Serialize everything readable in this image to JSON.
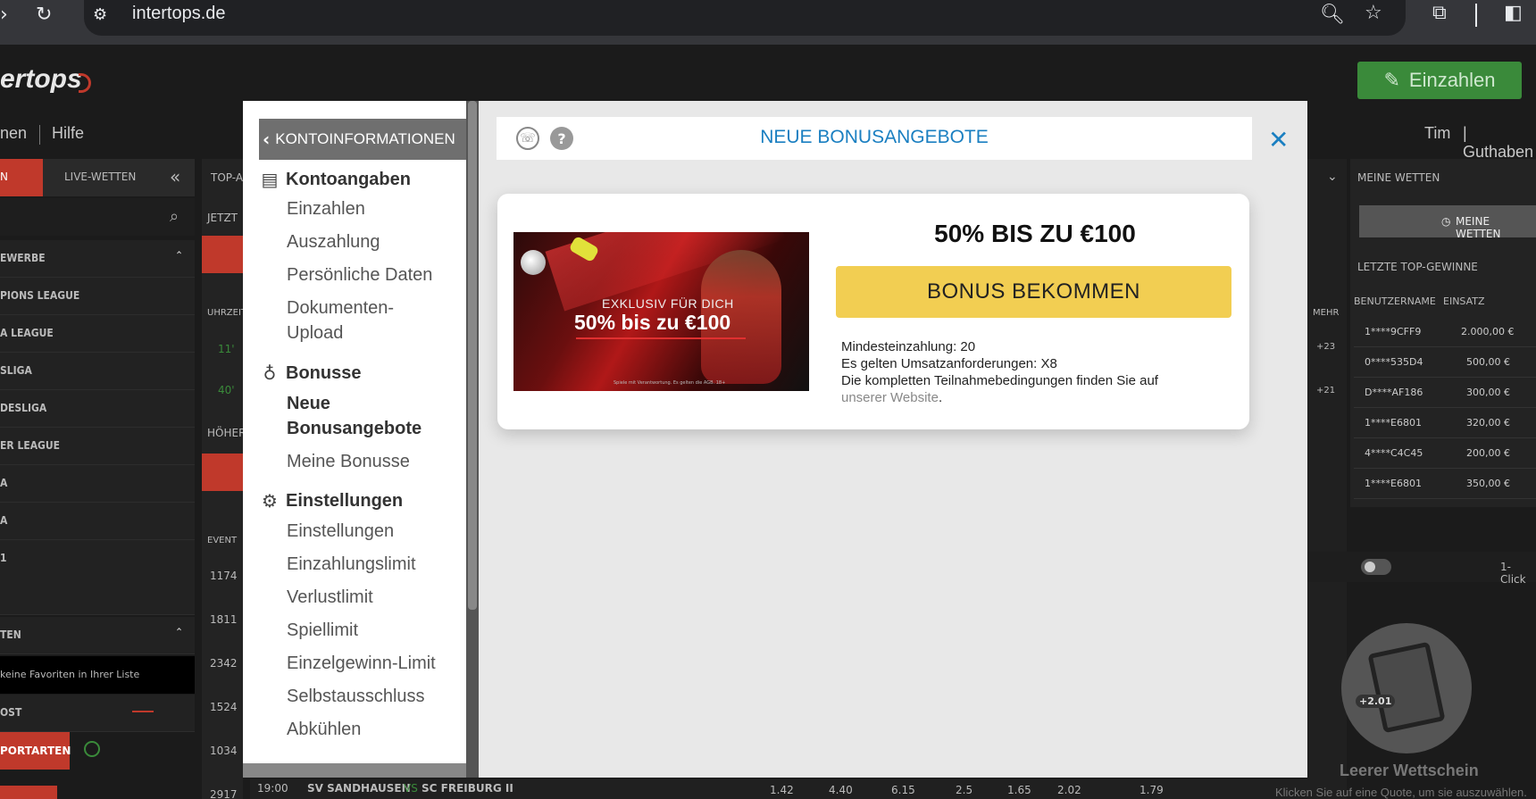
{
  "browser": {
    "url": "intertops.de"
  },
  "site": {
    "logo_text": "ertops",
    "deposit_label": "Einzahlen",
    "nav_left": [
      "nen",
      "Hilfe"
    ],
    "nav_right": [
      "Tim",
      "| Guthaben"
    ],
    "left_tabs": [
      "N",
      "LIVE-WETTEN"
    ],
    "left_sections": [
      "EWERBE",
      "PIONS LEAGUE",
      "A LEAGUE",
      "SLIGA",
      "DESLIGA",
      "ER LEAGUE",
      "A",
      "A",
      "1"
    ],
    "favorites_head": "TEN",
    "favorites_empty": "keine Favoriten in Ihrer Liste",
    "ost_label": "OST",
    "sportarten_label": "PORTARTEN",
    "center_labels": {
      "top": "TOP-A",
      "jetzt": "JETZT",
      "uhrzeit": "UHRZEIT",
      "hoher": "HÖHER",
      "event": "EVENT",
      "mehr": "MEHR",
      "time_11": "11'",
      "time_40": "40'",
      "plus_23": "+23",
      "plus_21": "+21"
    },
    "events": [
      "1174",
      "1811",
      "2342",
      "1524",
      "1034",
      "2917"
    ],
    "bottom_match": {
      "time": "19:00",
      "home": "SV SANDHAUSEN",
      "vs": "VS",
      "away": "SC FREIBURG II",
      "odds": [
        "1.42",
        "4.40",
        "6.15",
        "2.5",
        "1.65",
        "2.02",
        "1.79"
      ]
    },
    "right": {
      "my_bets_head": "MEINE WETTEN",
      "my_bets_btn": "MEINE WETTEN",
      "top_wins_head": "LETZTE TOP-GEWINNE",
      "col_user": "BENUTZERNAME",
      "col_stake": "EINSATZ",
      "wins": [
        {
          "user": "1****9CFF9",
          "stake": "2.000,00 €"
        },
        {
          "user": "0****535D4",
          "stake": "500,00 €"
        },
        {
          "user": "D****AF186",
          "stake": "300,00 €"
        },
        {
          "user": "1****E6801",
          "stake": "320,00 €"
        },
        {
          "user": "4****C4C45",
          "stake": "200,00 €"
        },
        {
          "user": "1****E6801",
          "stake": "350,00 €"
        }
      ],
      "one_click": "1-Click",
      "slip_badge": "+2.01",
      "empty_title": "Leerer Wettschein",
      "empty_sub": "Klicken Sie auf eine Quote, um sie auszuwählen."
    }
  },
  "modal": {
    "back_label": "KONTOINFORMATIONEN",
    "title": "NEUE BONUSANGEBOTE",
    "sections": [
      {
        "heading": "Kontoangaben",
        "icon": "id-card-icon",
        "links": [
          "Einzahlen",
          "Auszahlung",
          "Persönliche Daten",
          "Dokumenten-\nUpload"
        ]
      },
      {
        "heading": "Bonusse",
        "icon": "money-bag-icon",
        "links": [
          "Neue Bonusangebote",
          "Meine Bonusse"
        ]
      },
      {
        "heading": "Einstellungen",
        "icon": "gear-icon",
        "links": [
          "Einstellungen",
          "Einzahlungslimit",
          "Verlustlimit",
          "Spiellimit",
          "Einzelgewinn-Limit",
          "Selbstausschluss",
          "Abkühlen"
        ]
      }
    ],
    "offer": {
      "banner_small": "EXKLUSIV FÜR DICH",
      "banner_big": "50% bis zu €100",
      "banner_fine": "Spiele mit Verantwortung. Es gelten die AGB. 18+",
      "headline": "50% BIS ZU €100",
      "button_label": "BONUS BEKOMMEN",
      "min_deposit": "Mindesteinzahlung: 20",
      "wagering": "Es gelten Umsatzanforderungen: X8",
      "terms_text": "Die kompletten Teilnahmebedingungen finden Sie auf",
      "terms_link": "unserer Website",
      "terms_end": "."
    }
  }
}
